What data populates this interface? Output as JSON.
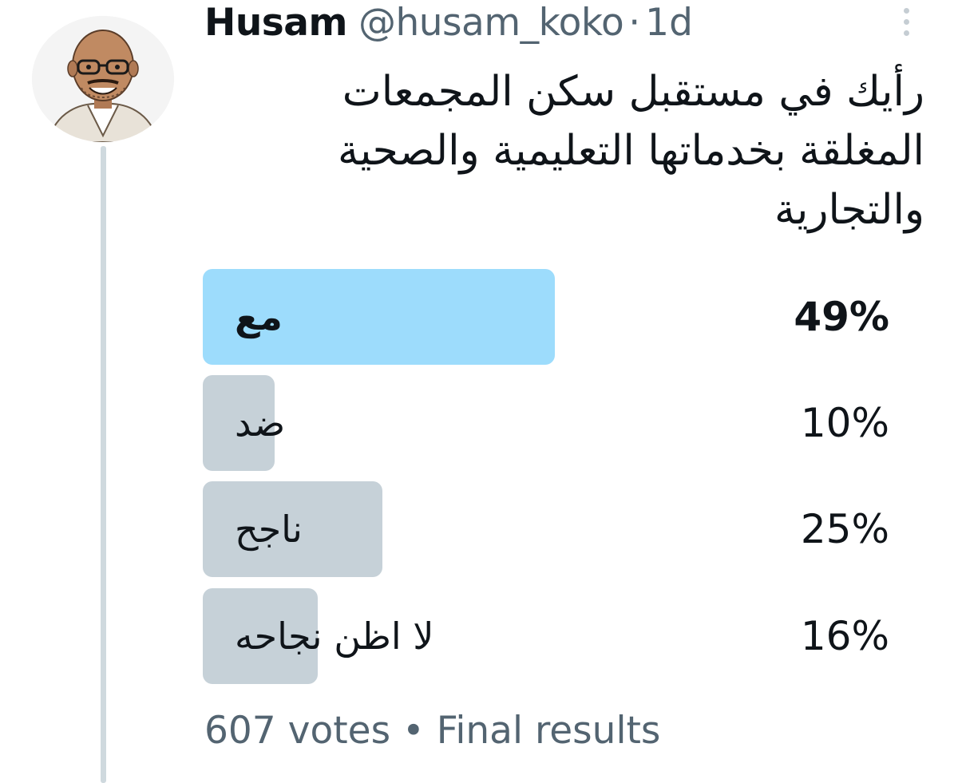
{
  "tweet": {
    "author": {
      "name": "Husam",
      "handle": "@husam_koko",
      "separator": "·",
      "time": "1d",
      "avatar": "profile-photo-caricature"
    },
    "question": "رأيك في مستقبل سكن المجمعات المغلقة بخدماتها التعليمية والصحية والتجارية",
    "menu_icon": "more-dots-vertical-icon"
  },
  "poll": {
    "options": [
      {
        "label": "مع",
        "percent_text": "49%",
        "percent": 49,
        "winner": true
      },
      {
        "label": "ضد",
        "percent_text": "10%",
        "percent": 10,
        "winner": false
      },
      {
        "label": "ناجح",
        "percent_text": "25%",
        "percent": 25,
        "winner": false
      },
      {
        "label": "لا اظن نجاحه",
        "percent_text": "16%",
        "percent": 16,
        "winner": false
      }
    ],
    "votes": "607 votes",
    "footer_separator": "•",
    "status": "Final results",
    "colors": {
      "winner_bar": "#9ddcfc",
      "other_bar": "#c6d1d8",
      "muted_text": "#536471",
      "thread_line": "#cfd9de"
    }
  }
}
